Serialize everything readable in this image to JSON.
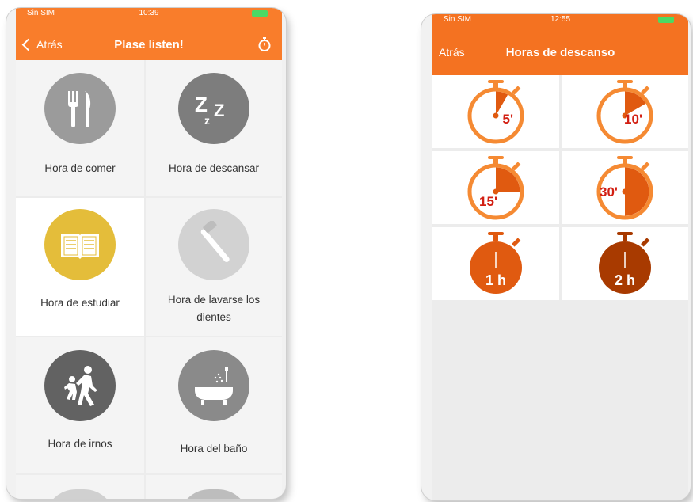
{
  "left_screen": {
    "status": {
      "carrier": "Sin SIM",
      "time": "10:39"
    },
    "nav": {
      "back_label": "Atrás",
      "title": "Plase listen!",
      "right_icon": "stopwatch-icon"
    },
    "tiles": [
      {
        "label": "Hora de comer",
        "icon": "fork-knife-icon",
        "color": "#9b9b9b"
      },
      {
        "label": "Hora de descansar",
        "icon": "sleep-zzz-icon",
        "color": "#7d7d7d"
      },
      {
        "label": "Hora de estudiar",
        "icon": "open-book-icon",
        "color": "#e4bd3a",
        "selected": true
      },
      {
        "label": "Hora de lavarse los dientes",
        "icon": "toothbrush-icon",
        "color": "#d2d2d2"
      },
      {
        "label": "Hora de irnos",
        "icon": "walking-people-icon",
        "color": "#626262"
      },
      {
        "label": "Hora del baño",
        "icon": "bathtub-icon",
        "color": "#8a8a8a"
      }
    ]
  },
  "right_screen": {
    "status": {
      "carrier": "Sin SIM",
      "time": "12:55"
    },
    "nav": {
      "back_label": "Atrás",
      "title": "Horas de descanso"
    },
    "timers": [
      {
        "label": "5'",
        "fraction": 0.083
      },
      {
        "label": "10'",
        "fraction": 0.167
      },
      {
        "label": "15'",
        "fraction": 0.25
      },
      {
        "label": "30'",
        "fraction": 0.5
      },
      {
        "label": "1 h",
        "fraction": 1.0
      },
      {
        "label": "2 h",
        "fraction": 1.0
      }
    ]
  },
  "colors": {
    "accent": "#f97d2b",
    "timer_light": "#f58a33",
    "timer_dark": "#e05a10",
    "timer_darker": "#a83a00"
  }
}
